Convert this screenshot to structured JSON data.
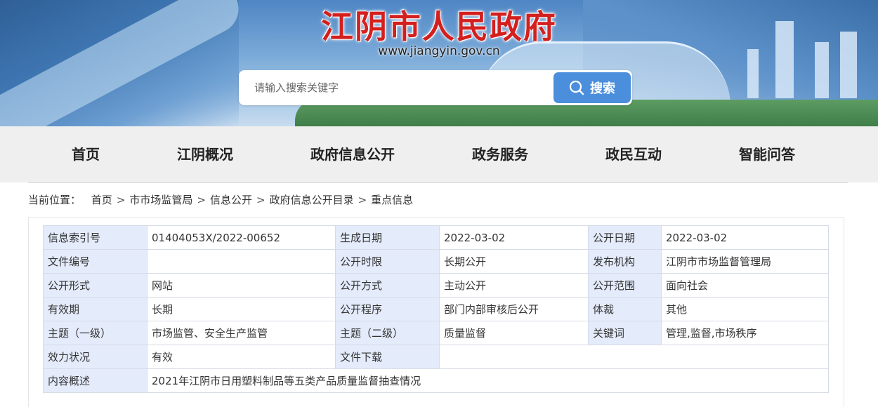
{
  "header": {
    "site_title": "江阴市人民政府",
    "site_url": "www.jiangyin.gov.cn",
    "search": {
      "placeholder": "请输入搜索关键字",
      "button_label": "搜索"
    }
  },
  "nav": {
    "items": [
      {
        "label": "首页"
      },
      {
        "label": "江阴概况"
      },
      {
        "label": "政府信息公开"
      },
      {
        "label": "政务服务"
      },
      {
        "label": "政民互动"
      },
      {
        "label": "智能问答"
      }
    ]
  },
  "breadcrumb": {
    "label": "当前位置：",
    "items": [
      {
        "label": "首页"
      },
      {
        "label": "市市场监管局"
      },
      {
        "label": "信息公开"
      },
      {
        "label": "政府信息公开目录"
      },
      {
        "label": "重点信息"
      }
    ],
    "separator": ">"
  },
  "info_table": {
    "index_no_label": "信息索引号",
    "index_no": "01404053X/2022-00652",
    "created_date_label": "生成日期",
    "created_date": "2022-03-02",
    "publish_date_label": "公开日期",
    "publish_date": "2022-03-02",
    "doc_no_label": "文件编号",
    "doc_no": "",
    "publish_term_label": "公开时限",
    "publish_term": "长期公开",
    "publisher_label": "发布机构",
    "publisher": "江阴市市场监督管理局",
    "publish_form_label": "公开形式",
    "publish_form": "网站",
    "publish_mode_label": "公开方式",
    "publish_mode": "主动公开",
    "publish_scope_label": "公开范围",
    "publish_scope": "面向社会",
    "validity_label": "有效期",
    "validity": "长期",
    "procedure_label": "公开程序",
    "procedure": "部门内部审核后公开",
    "genre_label": "体裁",
    "genre": "其他",
    "topic1_label": "主题（一级）",
    "topic1": "市场监管、安全生产监管",
    "topic2_label": "主题（二级）",
    "topic2": "质量监督",
    "keywords_label": "关键词",
    "keywords": "管理,监督,市场秩序",
    "status_label": "效力状况",
    "status": "有效",
    "download_label": "文件下载",
    "download": "",
    "summary_label": "内容概述",
    "summary": "2021年江阴市日用塑料制品等五类产品质量监督抽查情况"
  },
  "colors": {
    "title_red": "#d3201f",
    "search_button_blue": "#4a8edc",
    "nav_background": "#efefef",
    "table_label_background": "#e4ebfb",
    "table_border": "#d6dbe6"
  },
  "icons": {
    "search_button_icon": "search-icon"
  }
}
